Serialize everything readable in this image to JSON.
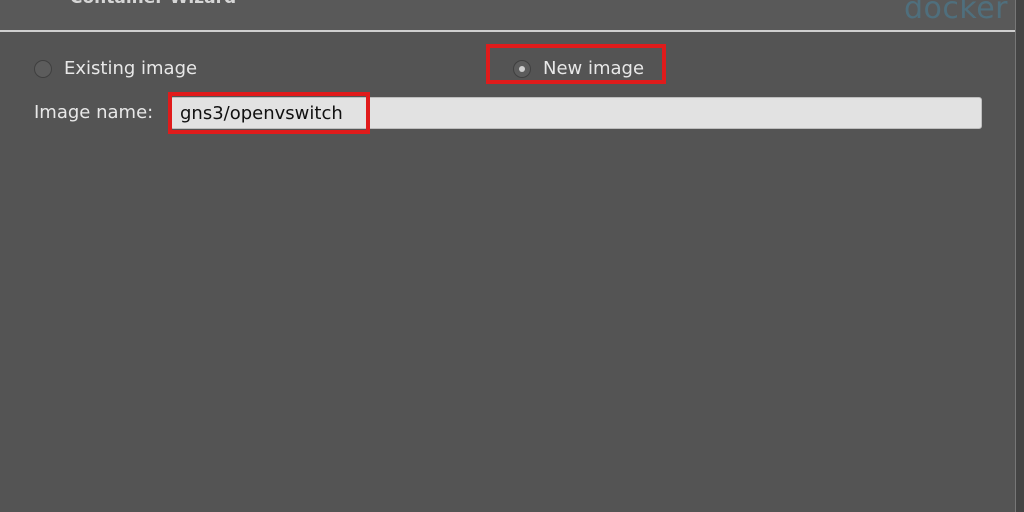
{
  "header": {
    "title": "Container Wizard",
    "brand": "docker"
  },
  "image_source": {
    "options": [
      {
        "label": "Existing image",
        "selected": false
      },
      {
        "label": "New image",
        "selected": true
      }
    ]
  },
  "image_name": {
    "label": "Image name:",
    "value": "gns3/openvswitch"
  },
  "colors": {
    "background": "#545454",
    "highlight": "#e01b1b",
    "input_background": "#e2e2e2",
    "brand": "#4f6f7d"
  }
}
